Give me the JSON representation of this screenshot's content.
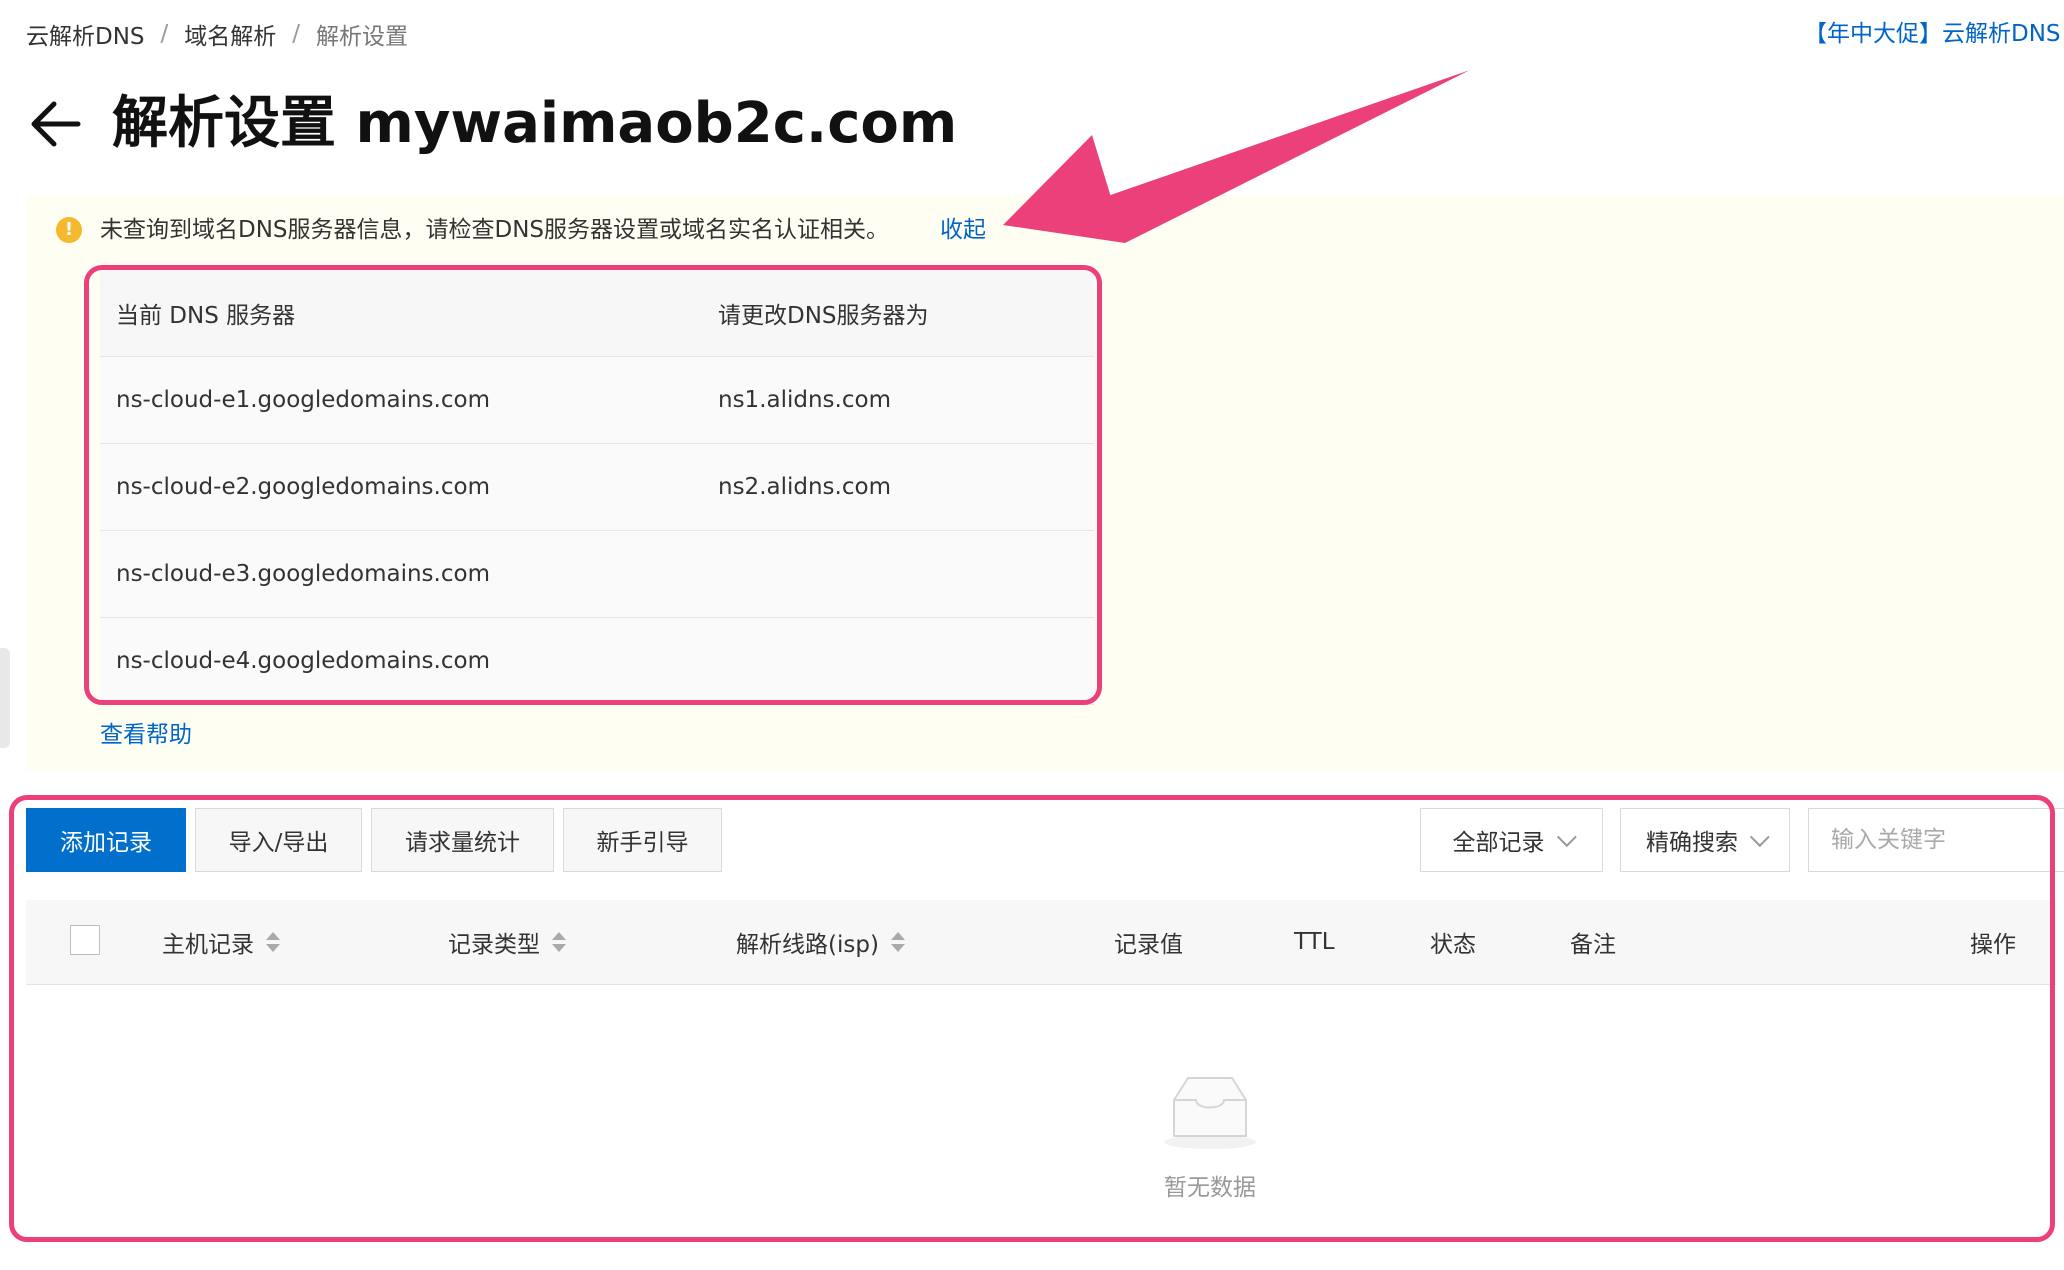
{
  "breadcrumb": {
    "items": [
      "云解析DNS",
      "域名解析",
      "解析设置"
    ],
    "separator": "/"
  },
  "promo_link": "【年中大促】云解析DNS",
  "title": {
    "text": "解析设置 mywaimaob2c.com"
  },
  "warning": {
    "icon": "!",
    "message": "未查询到域名DNS服务器信息，请检查DNS服务器设置或域名实名认证相关。",
    "collapse_label": "收起",
    "help_label": "查看帮助"
  },
  "dns_table": {
    "headers": [
      "当前 DNS 服务器",
      "请更改DNS服务器为"
    ],
    "rows": [
      [
        "ns-cloud-e1.googledomains.com",
        "ns1.alidns.com"
      ],
      [
        "ns-cloud-e2.googledomains.com",
        "ns2.alidns.com"
      ],
      [
        "ns-cloud-e3.googledomains.com",
        ""
      ],
      [
        "ns-cloud-e4.googledomains.com",
        ""
      ]
    ]
  },
  "toolbar": {
    "add_record": "添加记录",
    "import_export": "导入/导出",
    "request_stats": "请求量统计",
    "beginner_guide": "新手引导",
    "record_filter": "全部记录",
    "search_mode": "精确搜索",
    "search_placeholder": "输入关键字"
  },
  "records_table": {
    "columns": {
      "host": "主机记录",
      "type": "记录类型",
      "line": "解析线路(isp)",
      "value": "记录值",
      "ttl": "TTL",
      "status": "状态",
      "remark": "备注",
      "action": "操作"
    },
    "empty_text": "暂无数据"
  },
  "colors": {
    "primary": "#0070cc",
    "link": "#0064c8",
    "warning_bg": "#fffef2",
    "warning_icon": "#f5b82e",
    "annotation": "#ec407a"
  },
  "icons": [
    "back-arrow-icon",
    "warning-icon",
    "chevron-down-icon",
    "sort-icon",
    "empty-inbox-icon"
  ]
}
